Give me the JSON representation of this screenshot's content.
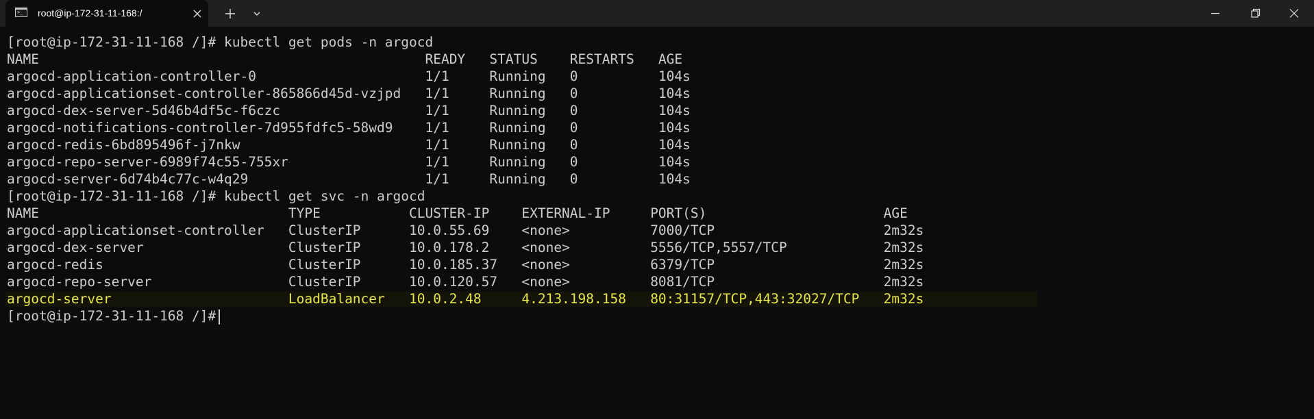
{
  "window": {
    "tab_title": "root@ip-172-31-11-168:/",
    "tab_icon": "terminal-icon",
    "controls": [
      "minimize-icon",
      "restore-icon",
      "close-icon"
    ]
  },
  "terminal": {
    "prompt": "[root@ip-172-31-11-168 /]#",
    "command_pods": "kubectl get pods -n argocd",
    "command_svc": "kubectl get svc -n argocd",
    "pods": {
      "headers": {
        "name": "NAME",
        "ready": "READY",
        "status": "STATUS",
        "restarts": "RESTARTS",
        "age": "AGE"
      },
      "rows": [
        {
          "name": "argocd-application-controller-0",
          "ready": "1/1",
          "status": "Running",
          "restarts": "0",
          "age": "104s"
        },
        {
          "name": "argocd-applicationset-controller-865866d45d-vzjpd",
          "ready": "1/1",
          "status": "Running",
          "restarts": "0",
          "age": "104s"
        },
        {
          "name": "argocd-dex-server-5d46b4df5c-f6czc",
          "ready": "1/1",
          "status": "Running",
          "restarts": "0",
          "age": "104s"
        },
        {
          "name": "argocd-notifications-controller-7d955fdfc5-58wd9",
          "ready": "1/1",
          "status": "Running",
          "restarts": "0",
          "age": "104s"
        },
        {
          "name": "argocd-redis-6bd895496f-j7nkw",
          "ready": "1/1",
          "status": "Running",
          "restarts": "0",
          "age": "104s"
        },
        {
          "name": "argocd-repo-server-6989f74c55-755xr",
          "ready": "1/1",
          "status": "Running",
          "restarts": "0",
          "age": "104s"
        },
        {
          "name": "argocd-server-6d74b4c77c-w4q29",
          "ready": "1/1",
          "status": "Running",
          "restarts": "0",
          "age": "104s"
        }
      ]
    },
    "svc": {
      "headers": {
        "name": "NAME",
        "type": "TYPE",
        "cluster_ip": "CLUSTER-IP",
        "external_ip": "EXTERNAL-IP",
        "ports": "PORT(S)",
        "age": "AGE"
      },
      "rows": [
        {
          "name": "argocd-applicationset-controller",
          "type": "ClusterIP",
          "cluster_ip": "10.0.55.69",
          "external_ip": "<none>",
          "ports": "7000/TCP",
          "age": "2m32s"
        },
        {
          "name": "argocd-dex-server",
          "type": "ClusterIP",
          "cluster_ip": "10.0.178.2",
          "external_ip": "<none>",
          "ports": "5556/TCP,5557/TCP",
          "age": "2m32s"
        },
        {
          "name": "argocd-redis",
          "type": "ClusterIP",
          "cluster_ip": "10.0.185.37",
          "external_ip": "<none>",
          "ports": "6379/TCP",
          "age": "2m32s"
        },
        {
          "name": "argocd-repo-server",
          "type": "ClusterIP",
          "cluster_ip": "10.0.120.57",
          "external_ip": "<none>",
          "ports": "8081/TCP",
          "age": "2m32s"
        },
        {
          "name": "argocd-server",
          "type": "LoadBalancer",
          "cluster_ip": "10.0.2.48",
          "external_ip": "4.213.198.158",
          "ports": "80:31157/TCP,443:32027/TCP",
          "age": "2m32s"
        }
      ]
    }
  },
  "colors": {
    "background": "#0c0c0c",
    "text": "#cccccc",
    "highlight_text": "#e5e54c",
    "titlebar": "#202020"
  }
}
